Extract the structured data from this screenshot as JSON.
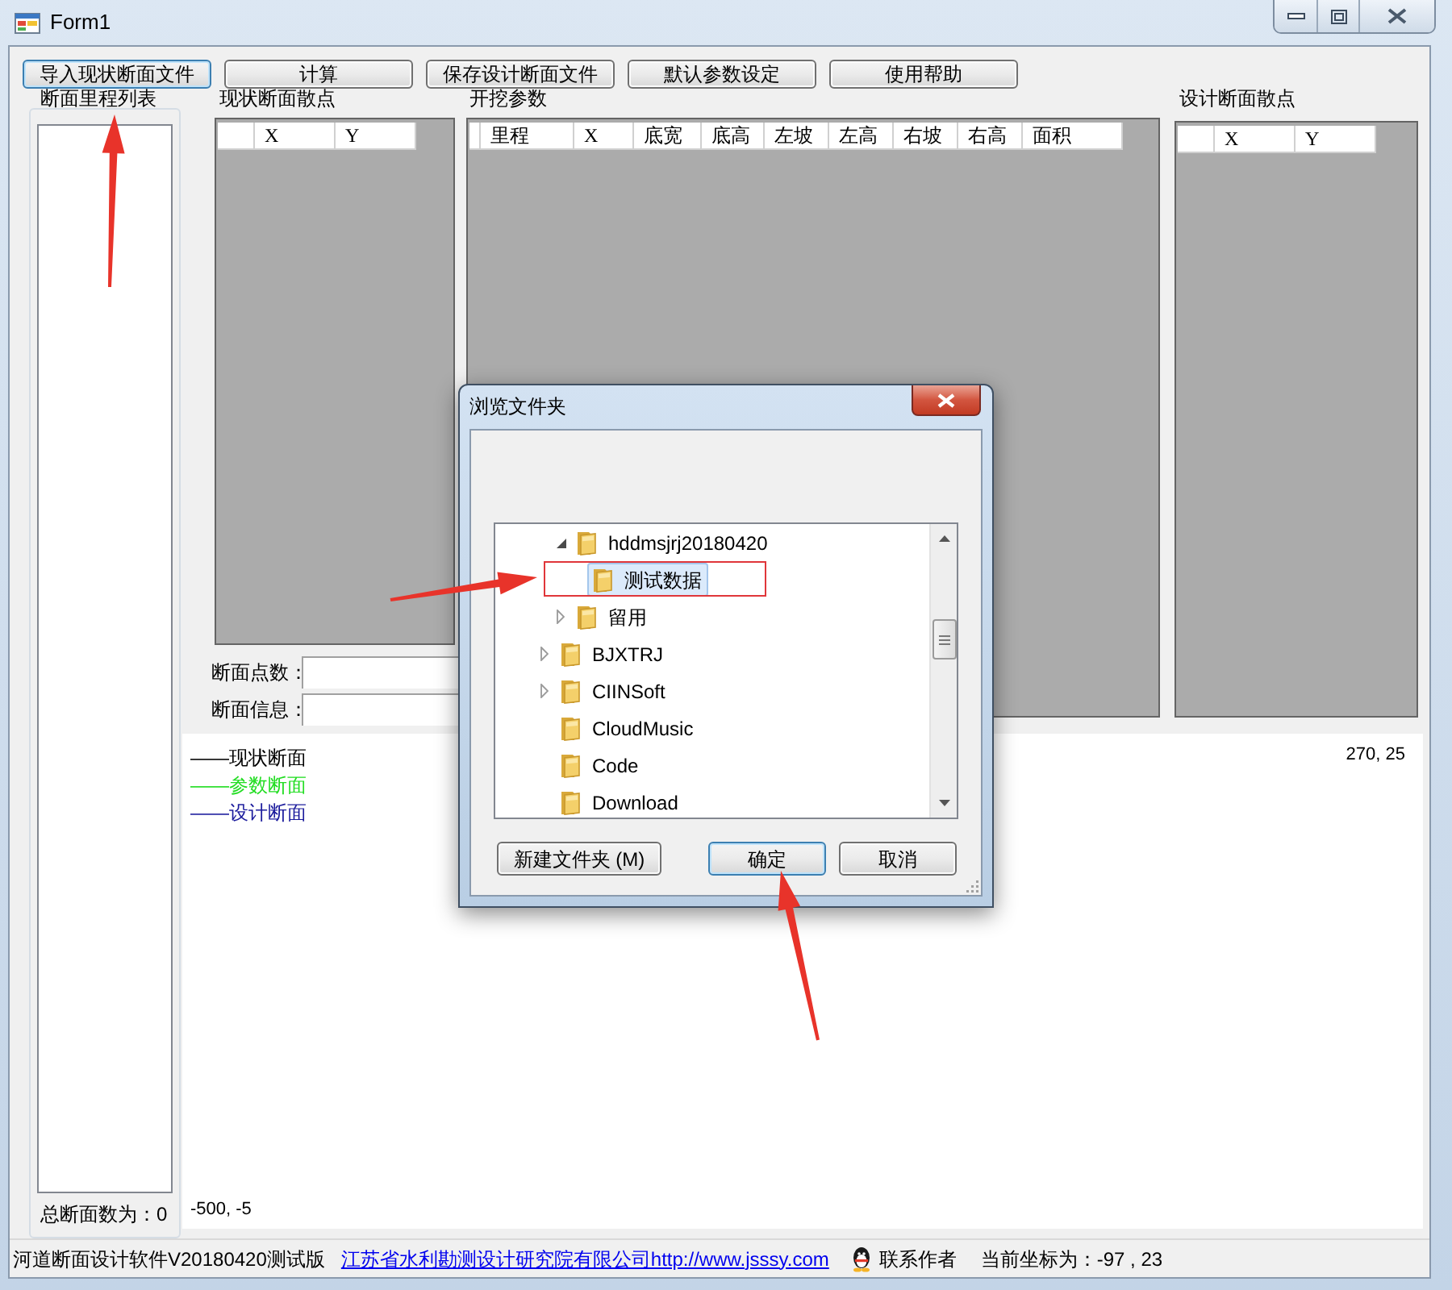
{
  "window": {
    "title": "Form1"
  },
  "toolbar": [
    {
      "label": "导入现状断面文件",
      "focused": true
    },
    {
      "label": "计算",
      "focused": false
    },
    {
      "label": "保存设计断面文件",
      "focused": false
    },
    {
      "label": "默认参数设定",
      "focused": false
    },
    {
      "label": "使用帮助",
      "focused": false
    }
  ],
  "section_list": {
    "title": "断面里程列表",
    "total": "总断面数为：0"
  },
  "existing_points": {
    "title": "现状断面散点",
    "columns": [
      "X",
      "Y"
    ],
    "fields": [
      {
        "label": "断面点数："
      },
      {
        "label": "断面信息："
      }
    ]
  },
  "excavation": {
    "title": "开挖参数",
    "columns": [
      "里程",
      "X",
      "底宽",
      "底高",
      "左坡",
      "左高",
      "右坡",
      "右高",
      "面积"
    ]
  },
  "design_points": {
    "title": "设计断面散点",
    "columns": [
      "X",
      "Y"
    ]
  },
  "plot": {
    "legend": [
      {
        "label": "——现状断面",
        "color": "#000000"
      },
      {
        "label": "——参数断面",
        "color": "#22dd22"
      },
      {
        "label": "——设计断面",
        "color": "#1a1a9c"
      }
    ],
    "top_right": "270, 25",
    "bottom_left": "-500, -5"
  },
  "status_bar": {
    "app_name": "河道断面设计软件V20180420测试版",
    "link": "江苏省水利勘测设计研究院有限公司http://www.jsssy.com",
    "contact": "联系作者",
    "coordinates": "当前坐标为：-97 , 23"
  },
  "dialog": {
    "title": "浏览文件夹",
    "tree": [
      {
        "children": [
          {
            "label": "hddmsjrj20180420",
            "expanded": true,
            "selected": false,
            "children": [
              {
                "label": "测试数据",
                "selected": true
              }
            ]
          },
          {
            "label": "留用",
            "expanded": false,
            "selected": false
          }
        ]
      },
      {
        "label": "BJXTRJ",
        "expanded": false,
        "selected": false
      },
      {
        "label": "CIINSoft",
        "expanded": false,
        "selected": false
      },
      {
        "label": "CloudMusic",
        "selected": false
      },
      {
        "label": "Code",
        "selected": false
      },
      {
        "label": "Download",
        "selected": false
      }
    ],
    "buttons": [
      {
        "label": "新建文件夹 (M)",
        "default": false
      },
      {
        "label": "确定",
        "default": true
      },
      {
        "label": "取消",
        "default": false
      }
    ]
  }
}
